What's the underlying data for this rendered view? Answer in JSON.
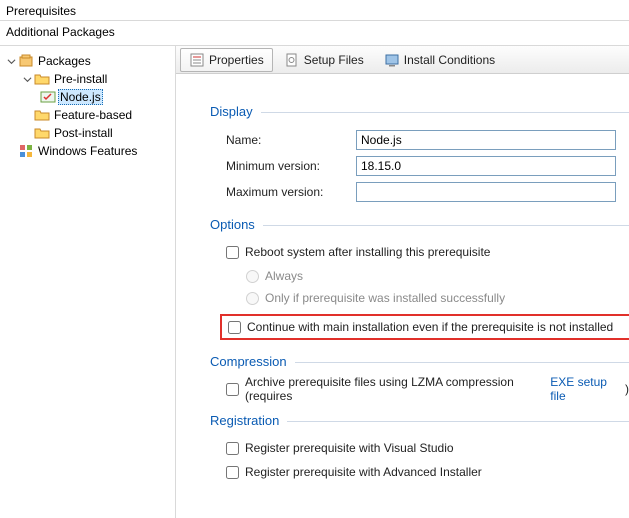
{
  "titles": {
    "prerequisites": "Prerequisites",
    "additional_packages": "Additional Packages"
  },
  "tree": {
    "packages": "Packages",
    "pre_install": "Pre-install",
    "nodejs": "Node.js",
    "feature_based": "Feature-based",
    "post_install": "Post-install",
    "windows_features": "Windows Features"
  },
  "tabs": {
    "properties": "Properties",
    "setup_files": "Setup Files",
    "install_conditions": "Install Conditions"
  },
  "sections": {
    "display": "Display",
    "options": "Options",
    "compression": "Compression",
    "registration": "Registration"
  },
  "display": {
    "name_label": "Name:",
    "name_value": "Node.js",
    "min_label": "Minimum version:",
    "min_value": "18.15.0",
    "max_label": "Maximum version:",
    "max_value": ""
  },
  "options": {
    "reboot": "Reboot system after installing this prerequisite",
    "always": "Always",
    "only_if": "Only if prerequisite was installed successfully",
    "continue": "Continue with main installation even if the prerequisite is not installed"
  },
  "compression": {
    "archive": "Archive prerequisite files using LZMA compression (requires",
    "link": "EXE setup file",
    "close": ")"
  },
  "registration": {
    "vs": "Register prerequisite with Visual Studio",
    "ai": "Register prerequisite with Advanced Installer"
  }
}
